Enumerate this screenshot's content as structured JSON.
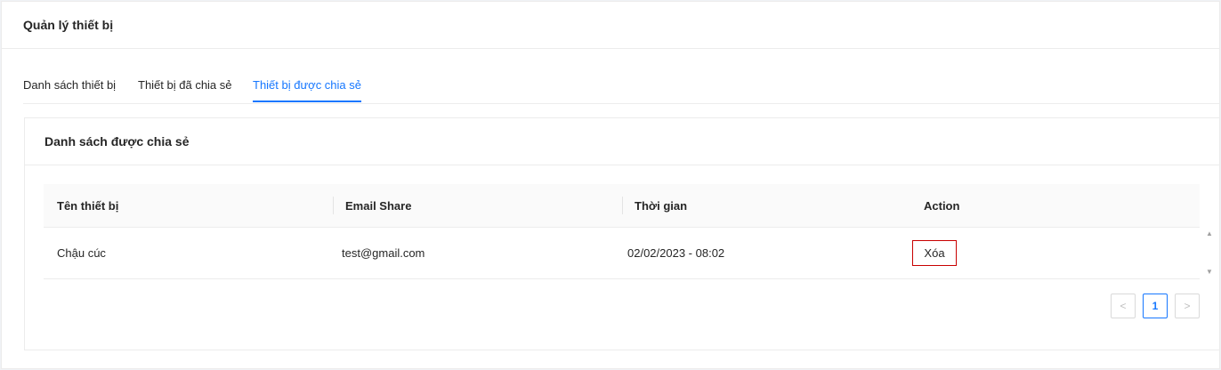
{
  "page": {
    "title": "Quản lý thiết bị"
  },
  "tabs": [
    {
      "label": "Danh sách thiết bị",
      "active": false
    },
    {
      "label": "Thiết bị đã chia sẻ",
      "active": false
    },
    {
      "label": "Thiết bị được chia sẻ",
      "active": true
    }
  ],
  "panel": {
    "title": "Danh sách được chia sẻ"
  },
  "table": {
    "columns": [
      "Tên thiết bị",
      "Email Share",
      "Thời gian",
      "Action"
    ],
    "rows": [
      {
        "device": "Chậu cúc",
        "email": "test@gmail.com",
        "time": "02/02/2023 - 08:02",
        "action": "Xóa"
      }
    ]
  },
  "pagination": {
    "prev": "<",
    "current": "1",
    "next": ">"
  },
  "icons": {
    "scroll_up": "▲",
    "scroll_down": "▼"
  },
  "colors": {
    "accent": "#1677ff",
    "danger_border": "#c80000"
  }
}
